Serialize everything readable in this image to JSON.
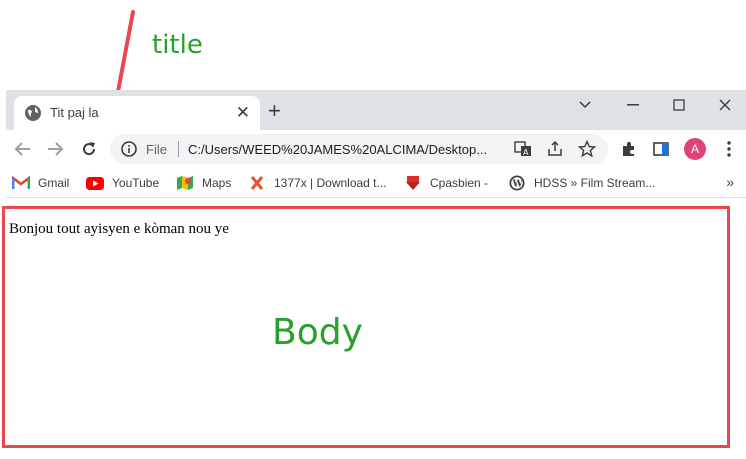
{
  "annotations": {
    "title_label": "title",
    "body_label": "Body"
  },
  "browser": {
    "tab": {
      "title": "Tit paj la"
    },
    "address": {
      "scheme_label": "File",
      "url": "C:/Users/WEED%20JAMES%20ALCIMA/Desktop..."
    },
    "profile_initial": "A",
    "bookmarks": [
      {
        "label": "Gmail",
        "icon": "gmail-icon"
      },
      {
        "label": "YouTube",
        "icon": "youtube-icon"
      },
      {
        "label": "Maps",
        "icon": "maps-icon"
      },
      {
        "label": "1377x | Download t...",
        "icon": "x-icon"
      },
      {
        "label": "Cpasbien -",
        "icon": "cpasbien-icon"
      },
      {
        "label": "HDSS » Film Stream...",
        "icon": "wordpress-icon"
      }
    ]
  },
  "page": {
    "body_text": "Bonjou tout ayisyen e kòman nou ye"
  },
  "colors": {
    "annotation_green": "#2aa02a",
    "annotation_red": "#e9484e"
  }
}
